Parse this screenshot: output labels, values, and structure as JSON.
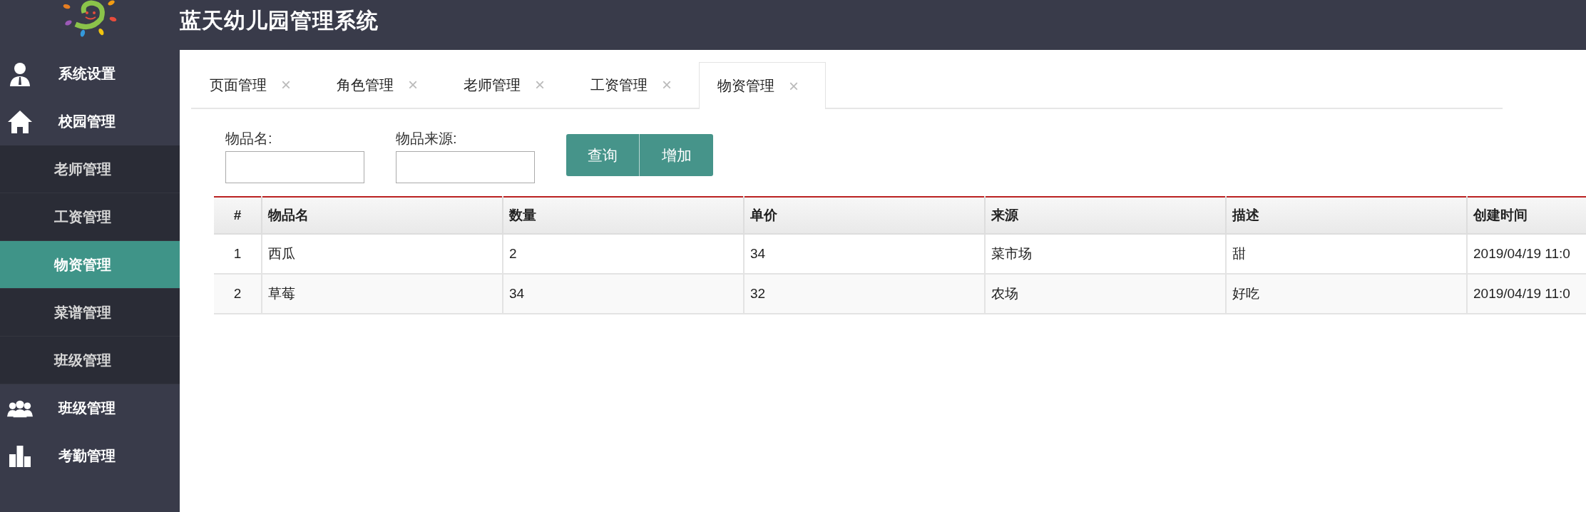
{
  "header": {
    "title": "蓝天幼儿园管理系统"
  },
  "sidebar": {
    "items": [
      {
        "label": "系统设置",
        "kind": "person",
        "selected": false
      },
      {
        "label": "校园管理",
        "kind": "home",
        "selected": false,
        "expanded": true,
        "children": [
          {
            "label": "老师管理",
            "selected": false
          },
          {
            "label": "工资管理",
            "selected": false
          },
          {
            "label": "物资管理",
            "selected": true
          },
          {
            "label": "菜谱管理",
            "selected": false
          },
          {
            "label": "班级管理",
            "selected": false
          }
        ]
      },
      {
        "label": "班级管理",
        "kind": "group",
        "selected": false
      },
      {
        "label": "考勤管理",
        "kind": "chart",
        "selected": false
      }
    ]
  },
  "tabs": [
    {
      "label": "页面管理",
      "close": "×",
      "selected": false
    },
    {
      "label": "角色管理",
      "close": "×",
      "selected": false
    },
    {
      "label": "老师管理",
      "close": "×",
      "selected": false
    },
    {
      "label": "工资管理",
      "close": "×",
      "selected": false
    },
    {
      "label": "物资管理",
      "close": "×",
      "selected": true
    }
  ],
  "filters": [
    {
      "label": "物品名:"
    },
    {
      "label": "物品来源:"
    }
  ],
  "buttons": [
    "查询",
    "增加"
  ],
  "table": {
    "columns": [
      "#",
      "物品名",
      "数量",
      "单价",
      "来源",
      "描述",
      "创建时间"
    ],
    "rows": [
      [
        "1",
        "西瓜",
        "2",
        "34",
        "菜市场",
        "甜",
        "2019/04/19 11:0"
      ],
      [
        "2",
        "草莓",
        "34",
        "32",
        "农场",
        "好吃",
        "2019/04/19 11:0"
      ]
    ]
  }
}
